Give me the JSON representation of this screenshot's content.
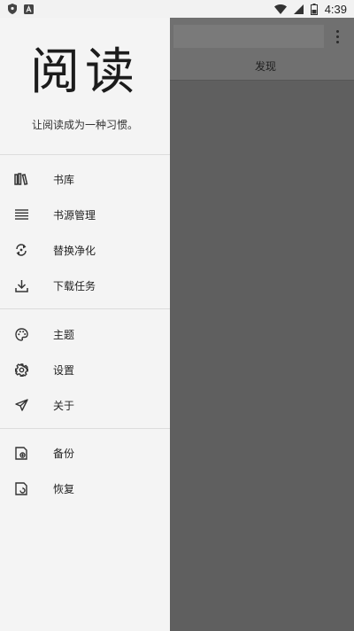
{
  "status_bar": {
    "time": "4:39",
    "icons": [
      "shield-icon",
      "a-icon",
      "wifi-icon",
      "signal-icon",
      "battery-icon"
    ]
  },
  "background_app": {
    "tab_label": "发现",
    "icons": [
      "more-vert-icon"
    ]
  },
  "drawer": {
    "logo_text": "阅读",
    "slogan": "让阅读成为一种习惯。",
    "groups": [
      [
        {
          "label": "书库",
          "icon": "bookshelf-icon"
        },
        {
          "label": "书源管理",
          "icon": "list-icon"
        },
        {
          "label": "替换净化",
          "icon": "replace-icon"
        },
        {
          "label": "下载任务",
          "icon": "download-icon"
        }
      ],
      [
        {
          "label": "主题",
          "icon": "palette-icon"
        },
        {
          "label": "设置",
          "icon": "gear-icon"
        },
        {
          "label": "关于",
          "icon": "send-icon"
        }
      ],
      [
        {
          "label": "备份",
          "icon": "backup-icon"
        },
        {
          "label": "恢复",
          "icon": "restore-icon"
        }
      ]
    ]
  },
  "colors": {
    "drawer_bg": "#f4f4f4",
    "scrim": "#5f5f5f",
    "text": "#222222"
  }
}
